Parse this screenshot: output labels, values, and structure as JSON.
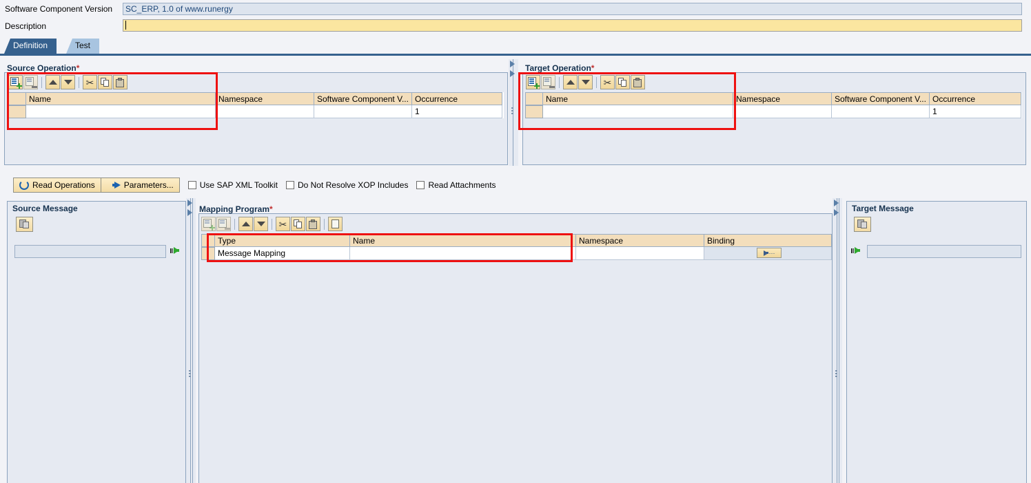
{
  "header": {
    "scv_label": "Software Component Version",
    "scv_value": "SC_ERP, 1.0 of www.runergy",
    "description_label": "Description",
    "description_value": ""
  },
  "tabs": [
    {
      "label": "Definition",
      "active": true
    },
    {
      "label": "Test",
      "active": false
    }
  ],
  "source_operation": {
    "title": "Source Operation",
    "required_marker": "*",
    "toolbar": [
      {
        "name": "insert-row-icon",
        "enabled": true
      },
      {
        "name": "delete-row-icon",
        "enabled": false
      },
      {
        "name": "move-up-icon",
        "enabled": true
      },
      {
        "name": "move-down-icon",
        "enabled": true
      },
      {
        "name": "cut-icon",
        "enabled": true
      },
      {
        "name": "copy-icon",
        "enabled": true
      },
      {
        "name": "paste-icon",
        "enabled": true
      }
    ],
    "columns": [
      "Name",
      "Namespace",
      "Software Component V...",
      "Occurrence"
    ],
    "rows": [
      {
        "name": "",
        "namespace": "",
        "scv": "",
        "occurrence": "1"
      }
    ]
  },
  "target_operation": {
    "title": "Target Operation",
    "required_marker": "*",
    "toolbar": [
      {
        "name": "insert-row-icon",
        "enabled": true
      },
      {
        "name": "delete-row-icon",
        "enabled": false
      },
      {
        "name": "move-up-icon",
        "enabled": true
      },
      {
        "name": "move-down-icon",
        "enabled": true
      },
      {
        "name": "cut-icon",
        "enabled": true
      },
      {
        "name": "copy-icon",
        "enabled": true
      },
      {
        "name": "paste-icon",
        "enabled": true
      }
    ],
    "columns": [
      "Name",
      "Namespace",
      "Software Component V...",
      "Occurrence"
    ],
    "rows": [
      {
        "name": "",
        "namespace": "",
        "scv": "",
        "occurrence": "1"
      }
    ]
  },
  "actionbar": {
    "read_operations_label": "Read Operations",
    "parameters_label": "Parameters...",
    "checkboxes": [
      {
        "label": "Use SAP XML Toolkit",
        "checked": false
      },
      {
        "label": "Do Not Resolve XOP Includes",
        "checked": false
      },
      {
        "label": "Read Attachments",
        "checked": false
      }
    ]
  },
  "source_message": {
    "title": "Source Message",
    "copy_button_name": "copy-source-message-button",
    "input_value": ""
  },
  "target_message": {
    "title": "Target Message",
    "copy_button_name": "copy-target-message-button",
    "input_value": ""
  },
  "mapping_program": {
    "title": "Mapping Program",
    "required_marker": "*",
    "toolbar": [
      {
        "name": "insert-row-icon",
        "enabled": false
      },
      {
        "name": "delete-row-icon",
        "enabled": false
      },
      {
        "name": "move-up-icon",
        "enabled": true
      },
      {
        "name": "move-down-icon",
        "enabled": true
      },
      {
        "name": "cut-icon",
        "enabled": true
      },
      {
        "name": "copy-icon",
        "enabled": true
      },
      {
        "name": "paste-icon",
        "enabled": true
      },
      {
        "name": "document-icon",
        "enabled": true
      }
    ],
    "columns": [
      "Type",
      "Name",
      "Namespace",
      "Binding"
    ],
    "rows": [
      {
        "type": "Message Mapping",
        "name": "",
        "namespace": "",
        "binding_button": true
      }
    ]
  },
  "annotations": {
    "color": "#ee1111",
    "boxes": [
      {
        "name": "source-operation-highlight"
      },
      {
        "name": "target-operation-highlight"
      },
      {
        "name": "mapping-program-row-highlight"
      }
    ]
  }
}
